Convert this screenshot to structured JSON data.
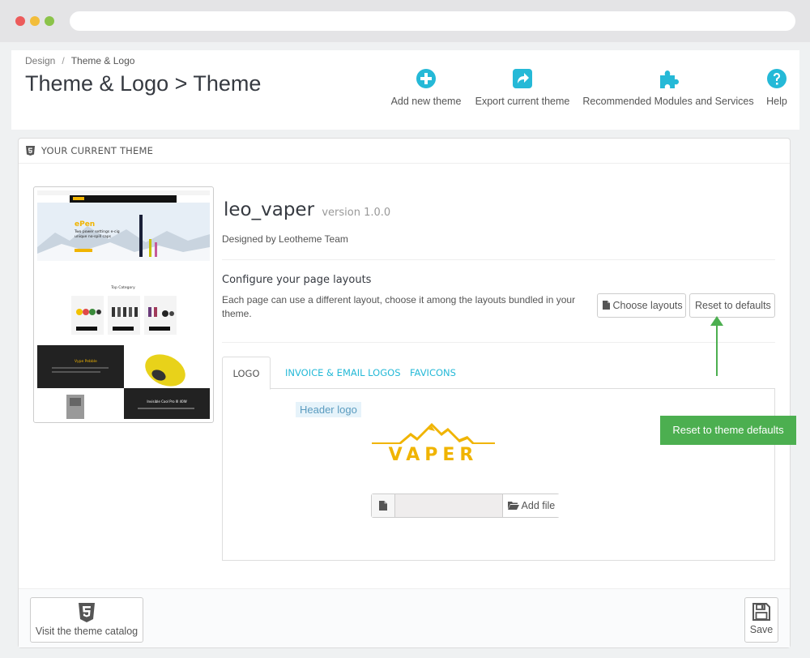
{
  "breadcrumb": {
    "parent": "Design",
    "current": "Theme & Logo"
  },
  "page_title": "Theme & Logo > Theme",
  "toolbar": {
    "add_new_theme": "Add new theme",
    "export_current_theme": "Export current theme",
    "recommended_modules": "Recommended Modules and Services",
    "help": "Help"
  },
  "panel": {
    "heading": "YOUR CURRENT THEME",
    "theme_name": "leo_vaper",
    "theme_version": "version 1.0.0",
    "designed_by": "Designed by Leotheme Team",
    "configure_title": "Configure your page layouts",
    "configure_desc": "Each page can use a different layout, choose it among the layouts bundled in your theme.",
    "choose_layouts": "Choose layouts",
    "reset_to_defaults": "Reset to defaults"
  },
  "thumbnail": {
    "hero_word": "ePen",
    "hero_line1": "Two power settings e-cig",
    "hero_line2": "unique no-spill caps",
    "top_category": "Top Category",
    "promo1": "Vype Pebble",
    "promo2": "Invisible Cool Pro III 40W"
  },
  "tabs": [
    {
      "label": "LOGO"
    },
    {
      "label": "INVOICE & EMAIL LOGOS"
    },
    {
      "label": "FAVICONS"
    }
  ],
  "logo_tab": {
    "header_logo_label": "Header logo",
    "logo_text": "VAPER",
    "add_file": "Add file"
  },
  "callout": "Reset to theme defaults",
  "footer": {
    "visit_catalog": "Visit the theme catalog",
    "save": "Save"
  },
  "colors": {
    "accent": "#25b9d7",
    "callout_green": "#4caf50",
    "logo_gold": "#f0b400"
  }
}
